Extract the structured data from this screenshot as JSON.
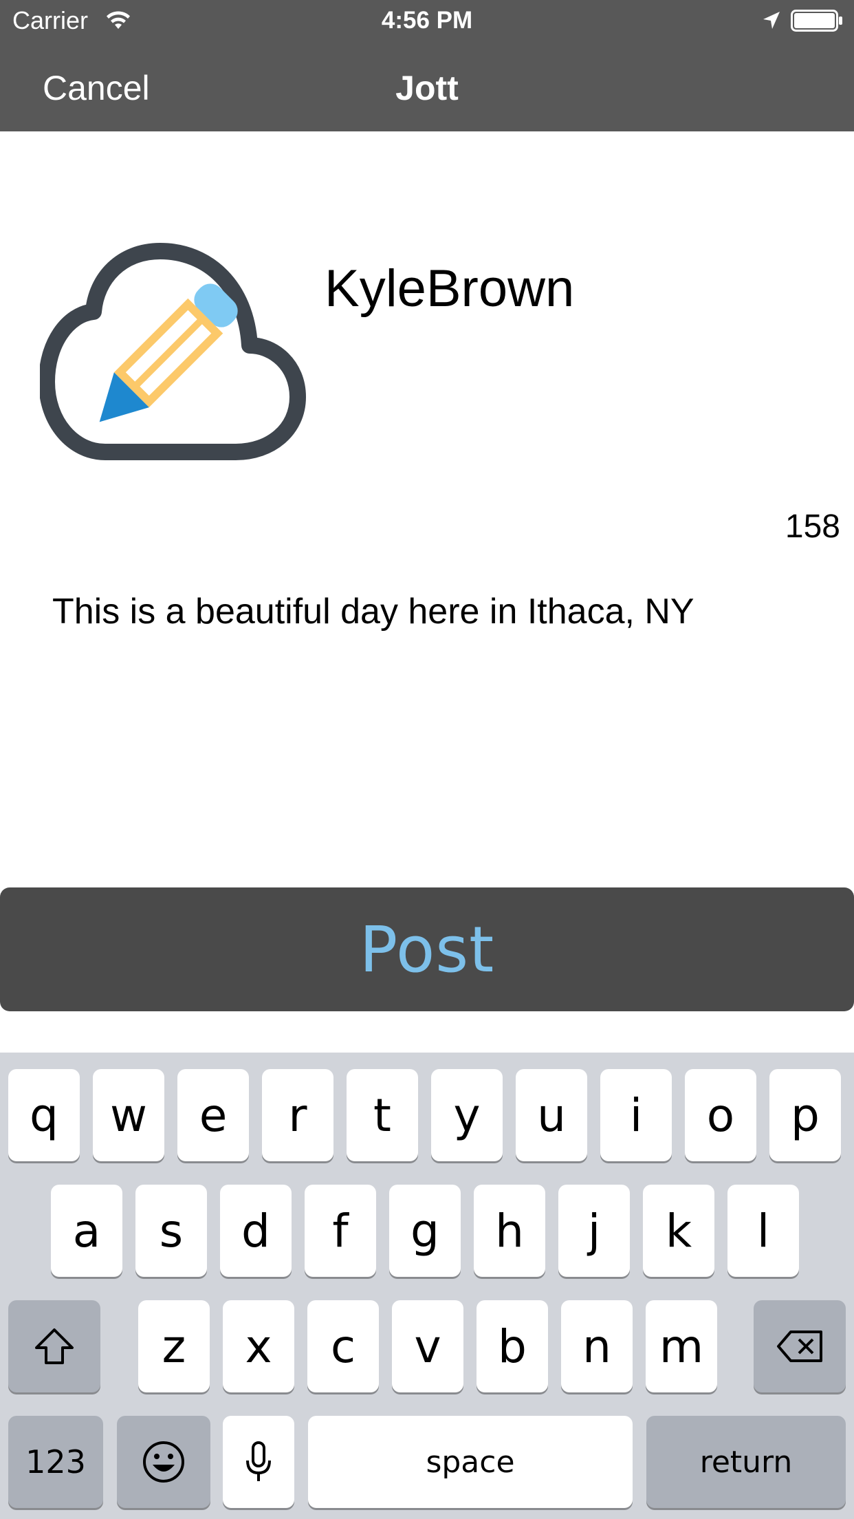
{
  "status_bar": {
    "carrier": "Carrier",
    "time": "4:56 PM",
    "icons": [
      "wifi-icon",
      "location-arrow-icon",
      "battery-icon"
    ]
  },
  "nav": {
    "cancel_label": "Cancel",
    "title": "Jott"
  },
  "profile": {
    "username": "KyleBrown",
    "logo": "cloud-pencil-logo"
  },
  "composer": {
    "char_count": "158",
    "text": "This is a beautiful day here in Ithaca, NY"
  },
  "post_button": {
    "label": "Post"
  },
  "keyboard": {
    "row1": [
      "q",
      "w",
      "e",
      "r",
      "t",
      "y",
      "u",
      "i",
      "o",
      "p"
    ],
    "row2": [
      "a",
      "s",
      "d",
      "f",
      "g",
      "h",
      "j",
      "k",
      "l"
    ],
    "row3": [
      "z",
      "x",
      "c",
      "v",
      "b",
      "n",
      "m"
    ],
    "numbers_label": "123",
    "space_label": "space",
    "return_label": "return",
    "icons": [
      "shift-icon",
      "backspace-icon",
      "emoji-icon",
      "microphone-icon"
    ]
  },
  "colors": {
    "nav_background": "#585858",
    "post_button_background": "#4a4a4a",
    "post_label": "#7dc0ea",
    "keyboard_background": "#d1d4da"
  }
}
